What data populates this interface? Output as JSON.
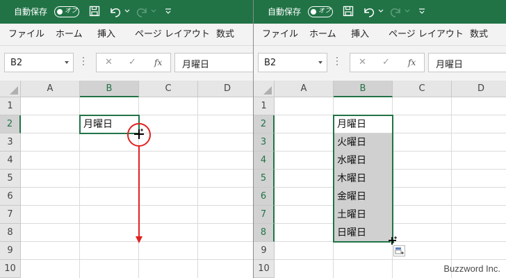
{
  "left": {
    "titlebar": {
      "autosave_label": "自動保存",
      "toggle_text": "オフ"
    },
    "ribbon": {
      "tabs": [
        "ファイル",
        "ホーム",
        "挿入",
        "ページ レイアウト",
        "数式"
      ]
    },
    "formula_bar": {
      "name_box": "B2",
      "formula": "月曜日"
    },
    "columns": [
      "A",
      "B",
      "C",
      "D"
    ],
    "rows": [
      "1",
      "2",
      "3",
      "4",
      "5",
      "6",
      "7",
      "8",
      "9",
      "10"
    ],
    "cells": {
      "B2": "月曜日"
    }
  },
  "right": {
    "titlebar": {
      "autosave_label": "自動保存",
      "toggle_text": "オフ"
    },
    "ribbon": {
      "tabs": [
        "ファイル",
        "ホーム",
        "挿入",
        "ページ レイアウト",
        "数式"
      ]
    },
    "formula_bar": {
      "name_box": "B2",
      "formula": "月曜日"
    },
    "columns": [
      "A",
      "B",
      "C",
      "D"
    ],
    "rows": [
      "1",
      "2",
      "3",
      "4",
      "5",
      "6",
      "7",
      "8",
      "9",
      "10"
    ],
    "cells": {
      "B2": "月曜日",
      "B3": "火曜日",
      "B4": "水曜日",
      "B5": "木曜日",
      "B6": "金曜日",
      "B7": "土曜日",
      "B8": "日曜日"
    }
  },
  "colors": {
    "titlebar": "#217346",
    "selection": "#217346",
    "annotation": "#e02020",
    "fill_highlight": "#d0d0d0"
  },
  "icons": [
    "save-icon",
    "undo-icon",
    "redo-icon",
    "customize-qat-icon",
    "cancel-icon",
    "enter-icon",
    "insert-function-icon",
    "fill-handle-cursor-icon",
    "auto-fill-options-icon"
  ],
  "watermark": "Buzzword Inc."
}
